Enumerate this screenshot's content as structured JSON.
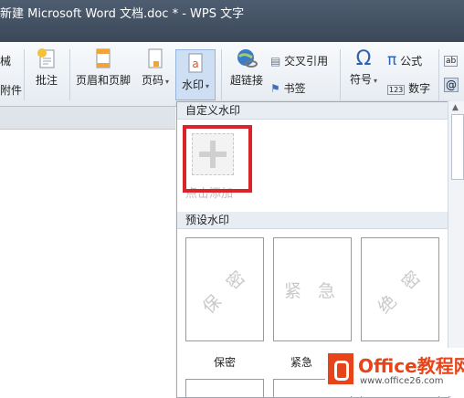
{
  "titlebar": {
    "title": "新建 Microsoft Word 文档.doc * - WPS 文字"
  },
  "ribbon": {
    "partial_left_top": "械",
    "partial_left_bottom": "附件",
    "comment": "批注",
    "header_footer": "页眉和页脚",
    "page_number": "页码",
    "watermark": "水印",
    "hyperlink": "超链接",
    "cross_ref": "交叉引用",
    "bookmark": "书签",
    "symbol": "符号",
    "formula": "公式",
    "number": "数字",
    "arrow": "▾"
  },
  "panel": {
    "custom_header": "自定义水印",
    "add_label": "点击添加",
    "preset_header": "预设水印",
    "presets": [
      {
        "text": "保密",
        "preview": "保 密"
      },
      {
        "text": "紧急",
        "preview": "紧 急"
      },
      {
        "text": "绝密",
        "preview": "绝 密"
      }
    ]
  },
  "brand": {
    "name": "Office教程网",
    "url": "www.office26.com"
  }
}
